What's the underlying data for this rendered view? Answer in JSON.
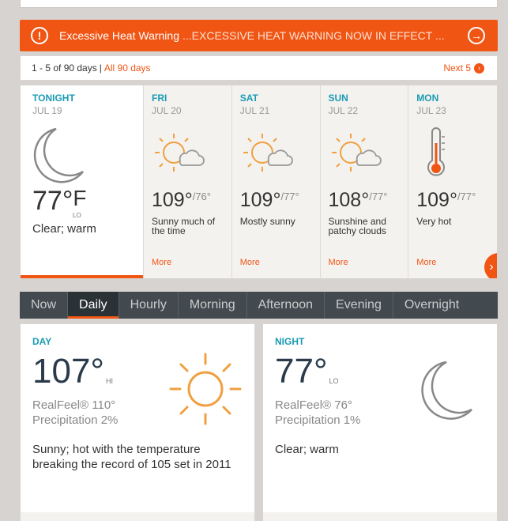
{
  "alert": {
    "title": "Excessive Heat Warning",
    "detail": "...EXCESSIVE HEAT WARNING NOW IN EFFECT ..."
  },
  "pager": {
    "range": "1 - 5 of 90 days",
    "separator": "|",
    "all_link": "All 90 days",
    "next_link": "Next 5"
  },
  "forecast": [
    {
      "name": "TONIGHT",
      "date": "JUL 19",
      "hi": "77°",
      "unit": "F",
      "lo": "",
      "lo_label": "LO",
      "phrase": "Clear; warm",
      "icon": "moon-icon",
      "more": ""
    },
    {
      "name": "FRI",
      "date": "JUL 20",
      "hi": "109°",
      "lo": "/76°",
      "phrase": "Sunny much of the time",
      "icon": "sun-cloud-icon",
      "more": "More"
    },
    {
      "name": "SAT",
      "date": "JUL 21",
      "hi": "109°",
      "lo": "/77°",
      "phrase": "Mostly sunny",
      "icon": "sun-cloud-icon",
      "more": "More"
    },
    {
      "name": "SUN",
      "date": "JUL 22",
      "hi": "108°",
      "lo": "/77°",
      "phrase": "Sunshine and patchy clouds",
      "icon": "sun-cloud-icon",
      "more": "More"
    },
    {
      "name": "MON",
      "date": "JUL 23",
      "hi": "109°",
      "lo": "/77°",
      "phrase": "Very hot",
      "icon": "thermometer-icon",
      "more": "More"
    }
  ],
  "tabs": [
    "Now",
    "Daily",
    "Hourly",
    "Morning",
    "Afternoon",
    "Evening",
    "Overnight"
  ],
  "active_tab": "Daily",
  "day_card": {
    "label": "DAY",
    "temp": "107°",
    "hl": "HI",
    "realfeel": "RealFeel® 110°",
    "precip": "Precipitation 2%",
    "desc": "Sunny; hot with the temperature breaking the record of 105 set in 2011"
  },
  "night_card": {
    "label": "NIGHT",
    "temp": "77°",
    "hl": "LO",
    "realfeel": "RealFeel® 76°",
    "precip": "Precipitation 1%",
    "desc": "Clear; warm"
  },
  "colors": {
    "accent": "#f05514",
    "teal": "#1a9bb3",
    "tabbar": "#424a4f"
  }
}
